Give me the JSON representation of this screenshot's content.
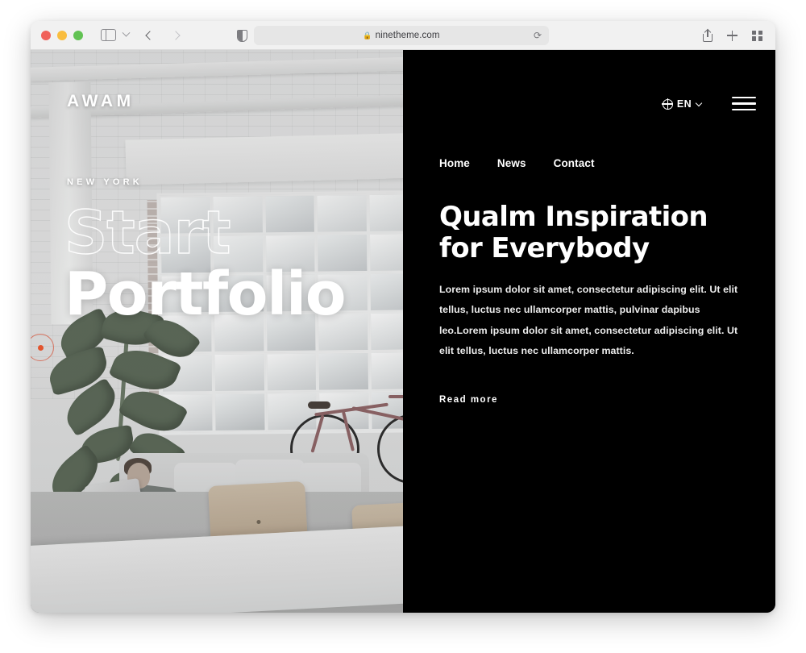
{
  "browser": {
    "traffic_lights": [
      "close",
      "minimize",
      "zoom"
    ],
    "sidebar_toggle_label": "Sidebar",
    "tab_overview_chevron": "chevron-down",
    "back_label": "Back",
    "forward_label": "Forward",
    "reader_label": "Reader",
    "url": "ninetheme.com",
    "lock_glyph": "🔒",
    "reload_glyph": "⟳",
    "share_label": "Share",
    "new_tab_label": "New Tab",
    "tab_overview_label": "Tab Overview"
  },
  "site": {
    "logo": "AWAM",
    "hero": {
      "eyebrow": "NEW YORK",
      "line_outline": "Start",
      "line_solid": "Portfolio"
    },
    "language": {
      "current": "EN",
      "icon": "globe-icon",
      "chevron": "chevron-down-icon"
    },
    "menu_icon": "hamburger-icon",
    "nav": [
      {
        "label": "Home"
      },
      {
        "label": "News"
      },
      {
        "label": "Contact"
      }
    ],
    "panel": {
      "headline": "Qualm Inspiration for Everybody",
      "paragraph": "Lorem ipsum dolor sit amet, consectetur adipiscing elit. Ut elit tellus, luctus nec ullamcorper mattis, pulvinar dapibus leo.Lorem ipsum dolor sit amet, consectetur adipiscing elit. Ut elit tellus, luctus nec ullamcorper mattis.",
      "cta": "Read more"
    },
    "colors": {
      "panel_bg": "#000000",
      "text": "#ffffff",
      "accent_dot": "#e2542e"
    }
  }
}
